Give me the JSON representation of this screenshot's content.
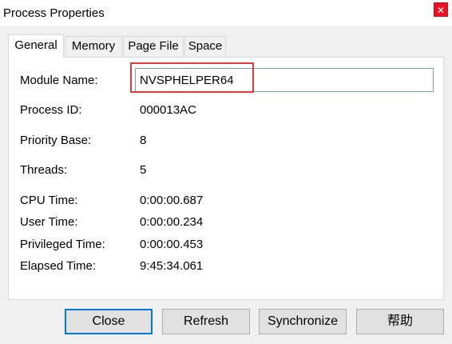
{
  "window": {
    "title": "Process Properties",
    "close_glyph": "✕"
  },
  "tabs": [
    {
      "label": "General",
      "active": true
    },
    {
      "label": "Memory",
      "active": false
    },
    {
      "label": "Page File",
      "active": false
    },
    {
      "label": "Space",
      "active": false
    }
  ],
  "general": {
    "module_name_label": "Module Name:",
    "module_name_value": "NVSPHELPER64",
    "process_id_label": "Process ID:",
    "process_id_value": "000013AC",
    "priority_base_label": "Priority Base:",
    "priority_base_value": "8",
    "threads_label": "Threads:",
    "threads_value": "5",
    "cpu_time_label": "CPU Time:",
    "cpu_time_value": "0:00:00.687",
    "user_time_label": "User Time:",
    "user_time_value": "0:00:00.234",
    "privileged_time_label": "Privileged Time:",
    "privileged_time_value": "0:00:00.453",
    "elapsed_time_label": "Elapsed Time:",
    "elapsed_time_value": "9:45:34.061"
  },
  "buttons": {
    "close": "Close",
    "refresh": "Refresh",
    "synchronize": "Synchronize",
    "help": "帮助"
  },
  "colors": {
    "highlight": "#e03b3b",
    "default_button_border": "#0078d7",
    "close_button": "#e81123"
  }
}
